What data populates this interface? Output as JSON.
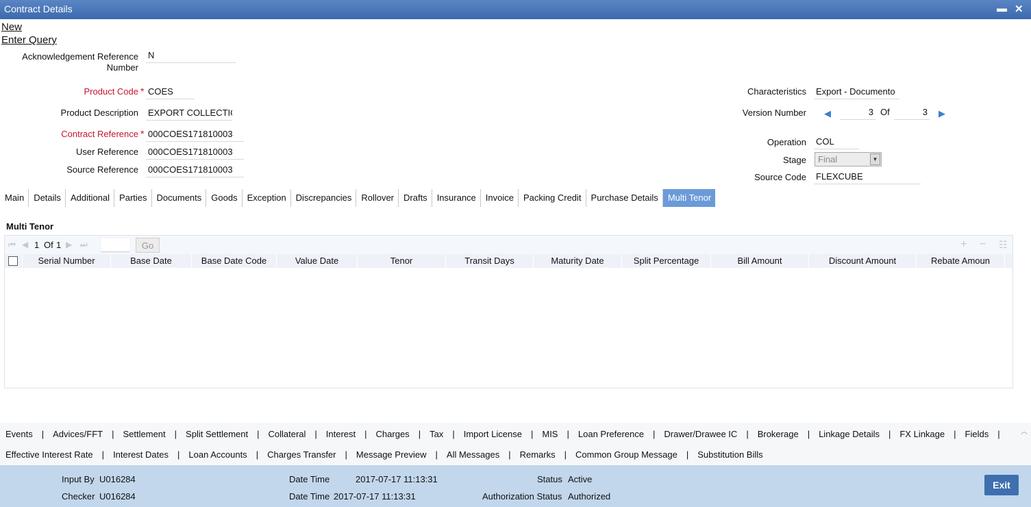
{
  "window": {
    "title": "Contract Details",
    "minimize": "▬",
    "close": "✕"
  },
  "actions": {
    "new": "New",
    "enter_query": "Enter Query"
  },
  "form": {
    "ack_ref_label_1": "Acknowledgement Reference",
    "ack_ref_label_2": "Number",
    "ack_ref_value": "N",
    "product_code_label": "Product Code",
    "product_code_value": "COES",
    "product_desc_label": "Product Description",
    "product_desc_value": "EXPORT COLLECTIO",
    "contract_ref_label": "Contract Reference",
    "contract_ref_value": "000COES171810003",
    "user_ref_label": "User Reference",
    "user_ref_value": "000COES171810003",
    "source_ref_label": "Source Reference",
    "source_ref_value": "000COES171810003",
    "required_mark": "*",
    "characteristics_label": "Characteristics",
    "characteristics_value": "Export  - Documento",
    "version_label": "Version Number",
    "version_current": "3",
    "version_of": "Of",
    "version_total": "3",
    "operation_label": "Operation",
    "operation_value": "COL",
    "stage_label": "Stage",
    "stage_value": "Final",
    "source_code_label": "Source Code",
    "source_code_value": "FLEXCUBE"
  },
  "tabs": [
    "Main",
    "Details",
    "Additional",
    "Parties",
    "Documents",
    "Goods",
    "Exception",
    "Discrepancies",
    "Rollover",
    "Drafts",
    "Insurance",
    "Invoice",
    "Packing Credit",
    "Purchase Details",
    "Multi Tenor"
  ],
  "active_tab": "Multi Tenor",
  "multi_tenor": {
    "title": "Multi Tenor",
    "pagination": {
      "page": "1",
      "of": "Of",
      "total": "1",
      "go": "Go"
    },
    "columns": [
      "Serial Number",
      "Base Date",
      "Base Date Code",
      "Value Date",
      "Tenor",
      "Transit Days",
      "Maturity Date",
      "Split Percentage",
      "Bill Amount",
      "Discount Amount",
      "Rebate Amoun"
    ],
    "rows": []
  },
  "footer_row1": [
    "Events",
    "Advices/FFT",
    "Settlement",
    "Split Settlement",
    "Collateral",
    "Interest",
    "Charges",
    "Tax",
    "Import License",
    "MIS",
    "Loan Preference",
    "Drawer/Drawee IC",
    "Brokerage",
    "Linkage Details",
    "FX Linkage",
    "Fields"
  ],
  "footer_row2": [
    "Effective Interest Rate",
    "Interest Dates",
    "Loan Accounts",
    "Charges Transfer",
    "Message Preview",
    "All Messages",
    "Remarks",
    "Common Group Message",
    "Substitution Bills"
  ],
  "separator": "|",
  "status": {
    "input_by_label": "Input By",
    "input_by_value": "U016284",
    "checker_label": "Checker",
    "checker_value": "U016284",
    "date_time_label": "Date Time",
    "date_time_1": "2017-07-17 11:13:31",
    "date_time_2": "2017-07-17 11:13:31",
    "status_label": "Status",
    "status_value": "Active",
    "auth_status_label": "Authorization Status",
    "auth_status_value": "Authorized",
    "exit": "Exit"
  }
}
